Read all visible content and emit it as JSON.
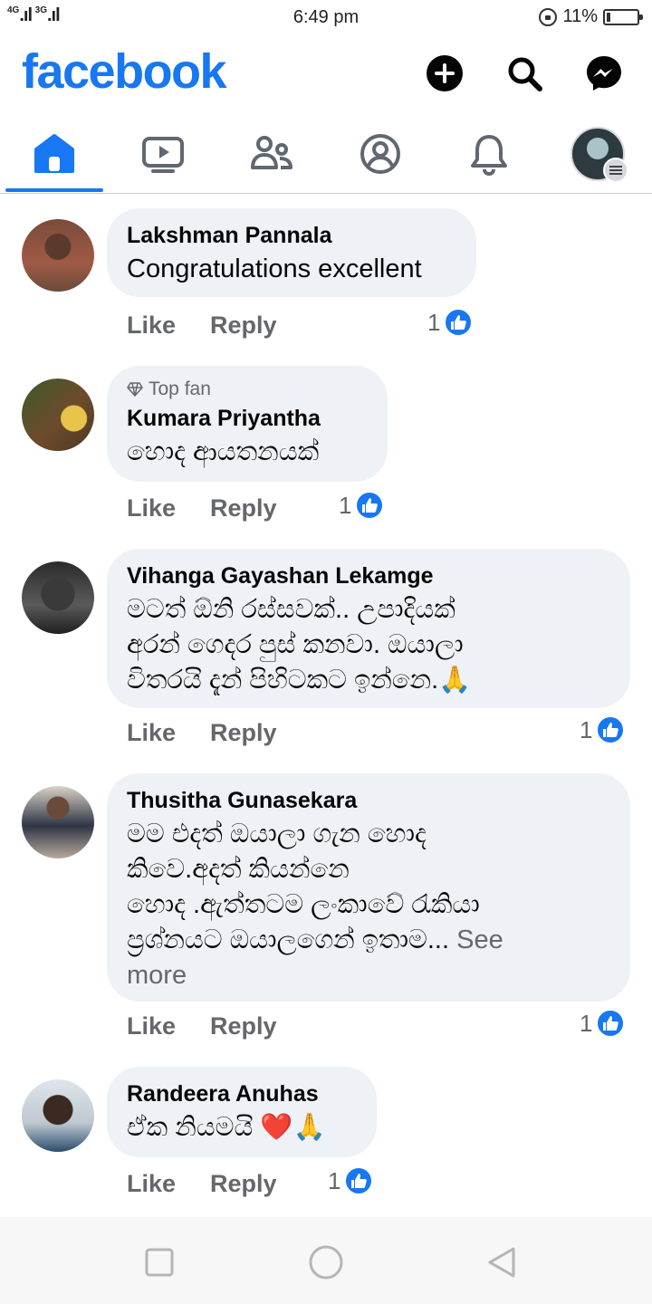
{
  "status_bar": {
    "network": "4G",
    "network2": "3G",
    "time": "6:49 pm",
    "battery": "11%"
  },
  "header": {
    "logo": "facebook",
    "brand_color": "#1877f2",
    "icons": [
      "plus-circle-icon",
      "search-icon",
      "messenger-icon"
    ]
  },
  "tabs": [
    {
      "name": "home",
      "icon": "home-icon",
      "active": true
    },
    {
      "name": "watch",
      "icon": "video-icon"
    },
    {
      "name": "friends",
      "icon": "friends-icon"
    },
    {
      "name": "profile",
      "icon": "profile-icon"
    },
    {
      "name": "notifications",
      "icon": "bell-icon"
    },
    {
      "name": "menu",
      "icon": "menu-icon"
    }
  ],
  "comments": [
    {
      "author": "Lakshman Pannala",
      "text": "Congratulations excellent",
      "like": "Like",
      "reply": "Reply",
      "reactions": "1"
    },
    {
      "badge": "Top fan",
      "author": "Kumara Priyantha",
      "text": "හොද ආයතනයක්",
      "like": "Like",
      "reply": "Reply",
      "reactions": "1"
    },
    {
      "author": "Vihanga Gayashan Lekamge",
      "text_lines": [
        "මටත් ඕනි රස්සවක්.. උපාදියක්",
        "අරන් ගෙදර පුස් කනවා.  ඔයාලා",
        "විතරයි දැන් පිහිටකට ඉන්නෙ.🙏"
      ],
      "like": "Like",
      "reply": "Reply",
      "reactions": "1"
    },
    {
      "author": "Thusitha Gunasekara",
      "text_lines": [
        "මම එදත් ඔයාලා ගැන හොද",
        "කිවෙ.අදත් කියන්නෙ",
        "හොද .ඇත්තටම ලංකාවේ රැකියා",
        "ප්‍රශ්නයට ඔයාලගෙන් ඉතාම..."
      ],
      "see_more": "See more",
      "see_more_1": "See",
      "see_more_2": "more",
      "like": "Like",
      "reply": "Reply",
      "reactions": "1"
    },
    {
      "author": "Randeera Anuhas",
      "text": "ඒක නියමයි ❤️🙏",
      "like": "Like",
      "reply": "Reply",
      "reactions": "1"
    }
  ]
}
